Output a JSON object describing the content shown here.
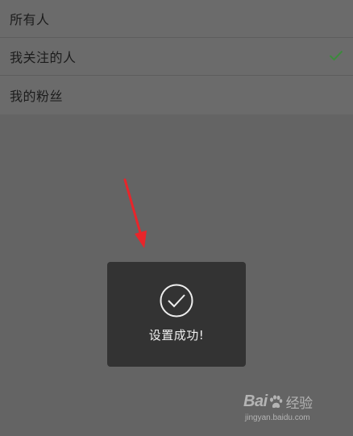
{
  "options": [
    {
      "label": "所有人",
      "selected": false
    },
    {
      "label": "我关注的人",
      "selected": true
    },
    {
      "label": "我的粉丝",
      "selected": false
    }
  ],
  "toast": {
    "message": "设置成功!"
  },
  "watermark": {
    "logo_left": "Bai",
    "logo_right": "经验",
    "url": "jingyan.baidu.com"
  },
  "colors": {
    "check": "#3c8a3c",
    "arrow": "#e8252a",
    "toast_bg": "#333333"
  }
}
